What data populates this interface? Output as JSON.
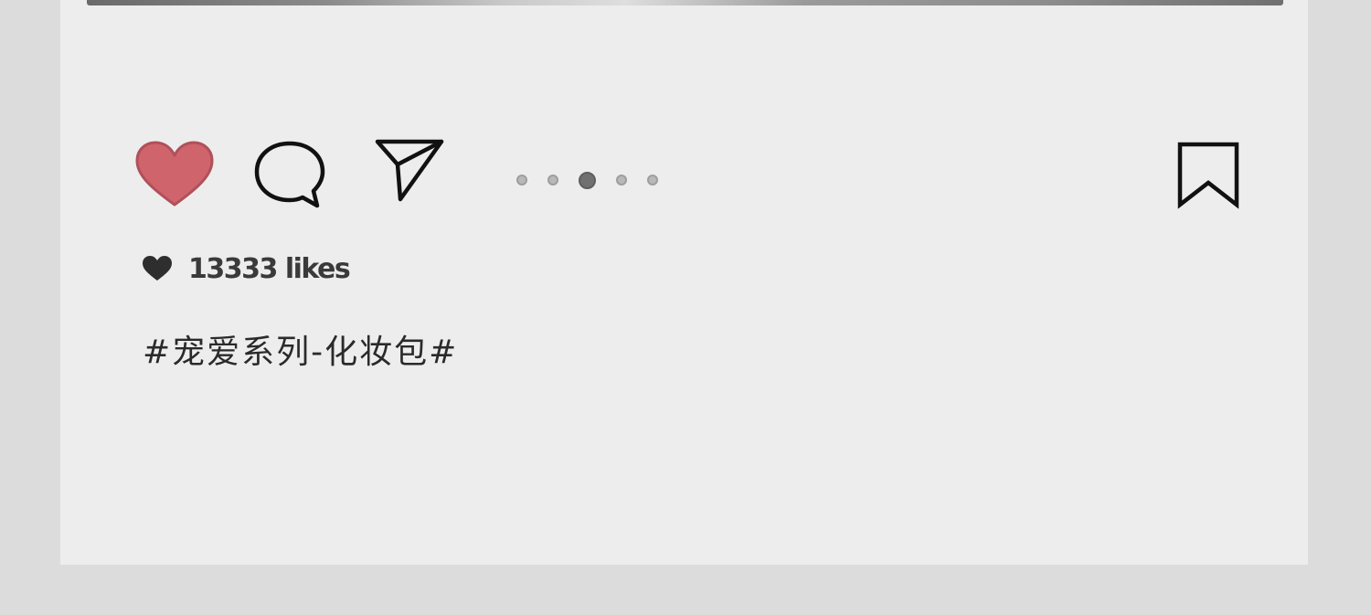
{
  "post": {
    "likes_text": "13333 likes",
    "caption": "#宠爱系列-化妆包#",
    "carousel": {
      "total_dots": 5,
      "active_index": 2
    }
  },
  "icons": {
    "like": "heart-icon",
    "comment": "comment-bubble-icon",
    "share": "paper-plane-icon",
    "save": "bookmark-icon",
    "likes_marker": "small-heart-icon"
  },
  "colors": {
    "like_heart": "#d0646c",
    "icon_stroke": "#111111",
    "card_background": "#ededed",
    "page_background": "#dcdcdc"
  }
}
